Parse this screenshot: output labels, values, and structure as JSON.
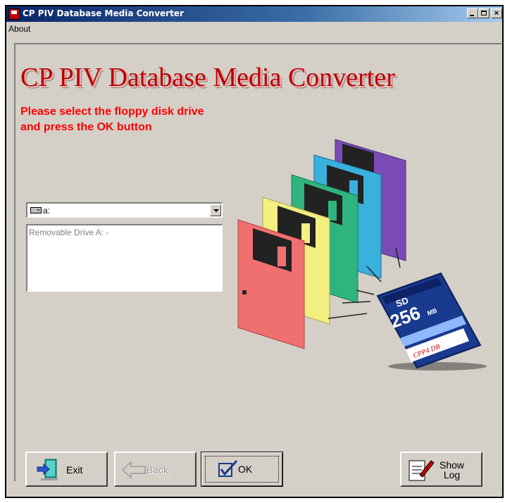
{
  "window": {
    "title": "CP PIV Database Media Converter",
    "controls": [
      "minimize",
      "maximize",
      "close"
    ]
  },
  "menu": {
    "items": [
      "About"
    ]
  },
  "banner": {
    "title": "CP PIV Database Media Converter"
  },
  "instruction": {
    "line1": "Please select the floppy disk drive",
    "line2": "and press the OK button"
  },
  "drive_select": {
    "value": "a:",
    "icon": "drive-icon"
  },
  "drive_info": {
    "text": "Removable Drive A: -"
  },
  "illustration": {
    "sd_card_size": "256",
    "sd_card_unit": "MB",
    "sd_card_brand": "SD",
    "sd_card_label": "CPP4 DB",
    "floppy_colors": [
      "#f07070",
      "#f3ef80",
      "#2fb47f",
      "#3ab0dc",
      "#7a4bb5"
    ]
  },
  "buttons": {
    "exit": "Exit",
    "back": "Back",
    "ok": "OK",
    "show_log_line1": "Show",
    "show_log_line2": "Log"
  }
}
